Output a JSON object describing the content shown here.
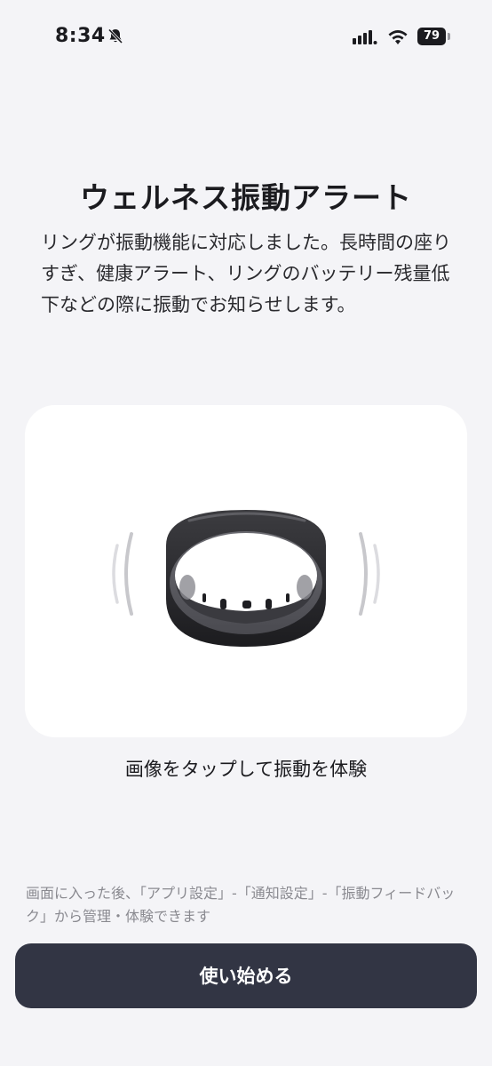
{
  "status_bar": {
    "time": "8:34",
    "battery_level": "79",
    "icons": [
      "bell-slash-icon",
      "signal-icon",
      "wifi-icon",
      "battery-icon"
    ]
  },
  "title": "ウェルネス振動アラート",
  "description": "リングが振動機能に対応しました。長時間の座りすぎ、健康アラート、リングのバッテリー残量低下などの際に振動でお知らせします。",
  "illustration": {
    "icon": "smart-ring-vibration-icon"
  },
  "caption": "画像をタップして振動を体験",
  "hint": "画面に入った後、「アプリ設定」-「通知設定」-「振動フィードバック」から管理・体験できます",
  "primary_button": {
    "label": "使い始める"
  },
  "colors": {
    "background": "#f4f4f7",
    "card": "#ffffff",
    "button": "#323544",
    "hint_text": "#8a8a90"
  }
}
